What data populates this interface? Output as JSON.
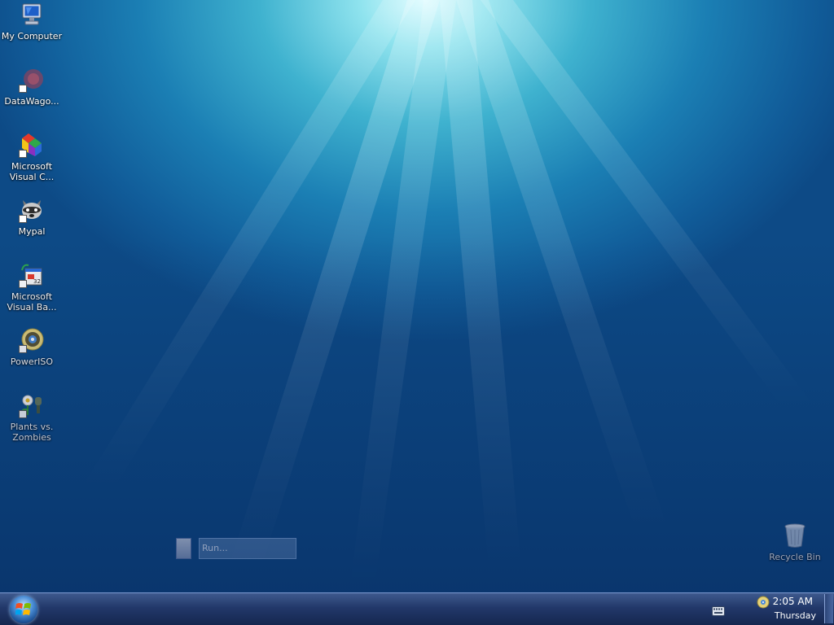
{
  "desktop": {
    "icons": [
      {
        "label": "My Computer",
        "icon": "computer-icon"
      },
      {
        "label": "DataWago...",
        "icon": "datawagon-icon"
      },
      {
        "label": "Microsoft\nVisual C...",
        "icon": "visual-c-icon"
      },
      {
        "label": "Mypal",
        "icon": "raccoon-icon"
      },
      {
        "label": "Microsoft\nVisual Ba...",
        "icon": "visual-basic-icon"
      },
      {
        "label": "PowerISO",
        "icon": "disc-icon"
      },
      {
        "label": "Plants vs.\nZombies",
        "icon": "plant-icon"
      }
    ],
    "recycle_bin": {
      "label": "Recycle Bin",
      "icon": "recycle-bin-icon"
    }
  },
  "run_box": {
    "placeholder": "Run..."
  },
  "taskbar": {
    "start_icon": "windows-logo-icon",
    "tray_icons": [
      "keyboard-icon",
      "cd-icon"
    ],
    "clock": {
      "time": "2:05 AM",
      "day": "Thursday"
    }
  }
}
